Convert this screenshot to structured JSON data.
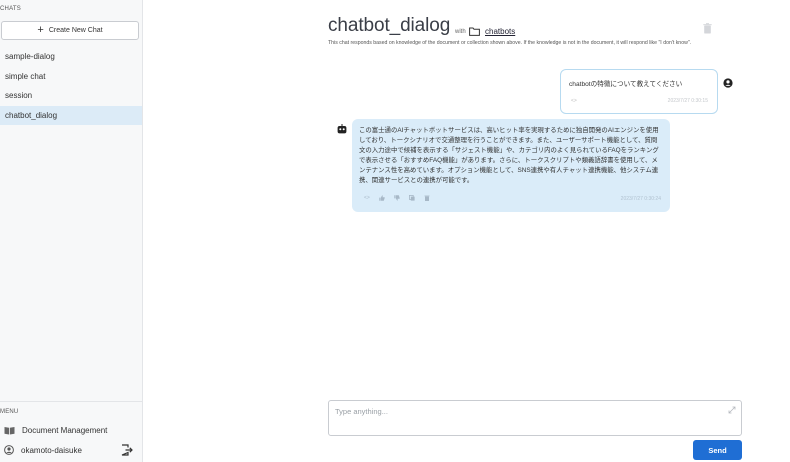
{
  "sidebar": {
    "chats_label": "CHATS",
    "new_chat_label": "Create New Chat",
    "items": [
      {
        "label": "sample-dialog"
      },
      {
        "label": "simple chat"
      },
      {
        "label": "session"
      },
      {
        "label": "chatbot_dialog"
      }
    ],
    "menu_label": "MENU",
    "document_management": "Document Management",
    "username": "okamoto-daisuke"
  },
  "header": {
    "title": "chatbot_dialog",
    "with_label": "with",
    "collection": "chatbots",
    "description": "This chat responds based on knowledge of the document or collection shown above. If the knowledge is not in the document, it will respond like \"I don't know\"."
  },
  "messages": [
    {
      "role": "user",
      "text": "chatbotの特徴について教えてください",
      "code_icon": "<>",
      "timestamp": "2023/7/27 0:30:15"
    },
    {
      "role": "assistant",
      "text": "この富士通のAIチャットボットサービスは、高いヒット率を実現するために独自開発のAIエンジンを使用しており、トークシナリオで交通整理を行うことができます。また、ユーザーサポート機能として、質問文の入力途中で候補を表示する「サジェスト機能」や、カテゴリ内のよく見られているFAQをランキングで表示させる「おすすめFAQ機能」があります。さらに、トークスクリプトや類義語辞書を使用して、メンテナンス性を高めています。オプション機能として、SNS連携や有人チャット連携機能、他システム連携、関連サービスとの連携が可能です。",
      "code_icon": "<>",
      "timestamp": "2023/7/27 0:30:24"
    }
  ],
  "input": {
    "placeholder": "Type anything...",
    "value": ""
  },
  "send_label": "Send",
  "colors": {
    "accent": "#1f6ed4",
    "active_item": "#dcebf7",
    "bot_bubble": "#daecf9",
    "user_border": "#b7daf0"
  },
  "icons": {
    "new_chat": "plus-icon",
    "collection": "folder-icon",
    "delete": "trash-icon",
    "user": "user-avatar-icon",
    "bot": "robot-icon",
    "document": "book-icon",
    "account": "account-circle-icon",
    "logout": "logout-icon",
    "expand": "expand-icon"
  }
}
